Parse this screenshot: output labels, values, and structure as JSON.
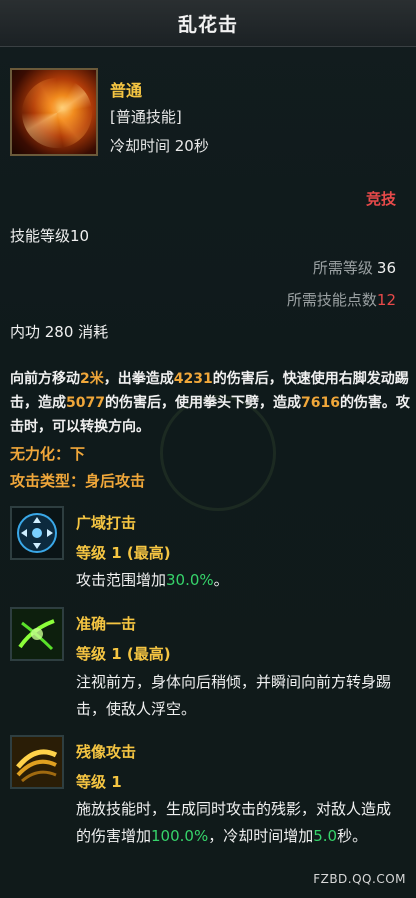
{
  "title": "乱花击",
  "skill": {
    "grade": "普通",
    "type": "[普通技能]",
    "cooldown": "冷却时间 20秒",
    "pvp_tag": "竞技",
    "level_label": "技能等级10",
    "req_level_label": "所需等级",
    "req_level_value": "36",
    "req_points_label": "所需技能点数",
    "req_points_value": "12",
    "cost": "内功 280 消耗",
    "desc": {
      "p1": "向前方移动",
      "v1": "2米",
      "p2": "，出拳造成",
      "v2": "4231",
      "p3": "的伤害后，快速使用右脚发动踢击，造成",
      "v3": "5077",
      "p4": "的伤害后，使用拳头下劈，造成",
      "v4": "7616",
      "p5": "的伤害。攻击时，可以转换方向。"
    },
    "weakness": "无力化：下",
    "attack_type": "攻击类型：身后攻击"
  },
  "sub_skills": [
    {
      "icon": "area-strike-icon",
      "name": "广域打击",
      "level": "等级 1 (最高)",
      "desc_a": "攻击范围增加",
      "desc_val": "30.0%",
      "desc_b": "。"
    },
    {
      "icon": "precise-strike-icon",
      "name": "准确一击",
      "level": "等级 1 (最高)",
      "desc": "注视前方，身体向后稍倾，并瞬间向前方转身踢击，使敌人浮空。"
    },
    {
      "icon": "afterimage-icon",
      "name": "残像攻击",
      "level": "等级 1",
      "desc_a": "施放技能时，生成同时攻击的残影，对敌人造成的伤害增加",
      "desc_val1": "100.0%",
      "desc_b": "，冷却时间增加",
      "desc_val2": "5.0",
      "desc_c": "秒。"
    }
  ],
  "watermark": "FZBD.QQ.COM",
  "colors": {
    "gold": "#f5c542",
    "orange": "#f0a73a",
    "red": "#e84a4a",
    "green": "#36d36a"
  }
}
